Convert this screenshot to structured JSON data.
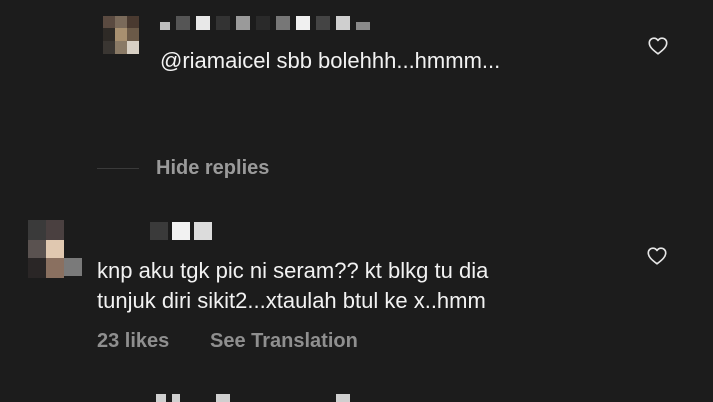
{
  "reply": {
    "text": "@riamaicel sbb bolehhh...hmmm..."
  },
  "replies_toggle": {
    "label": "Hide replies"
  },
  "comment": {
    "line1": "knp aku tgk pic ni seram?? kt blkg tu dia",
    "line2": "tunjuk diri sikit2...xtaulah btul ke x..hmm",
    "likes": "23 likes",
    "translation": "See Translation"
  },
  "icons": {
    "like": "heart-outline-icon"
  },
  "colors": {
    "background": "#1c1c1c",
    "text": "#f2f2f2",
    "muted": "#9a9a9a"
  }
}
